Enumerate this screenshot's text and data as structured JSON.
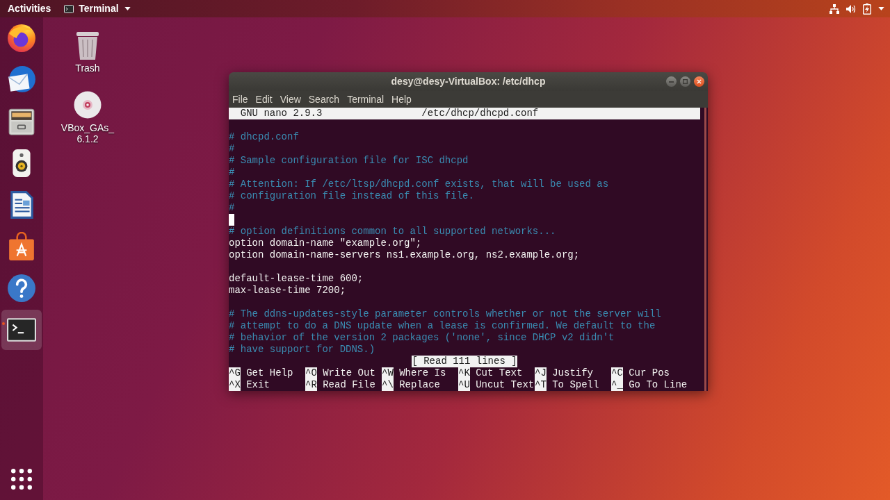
{
  "top_bar": {
    "activities": "Activities",
    "app_menu": "Terminal"
  },
  "dock": {
    "items": [
      {
        "kind": "browser",
        "focused": false,
        "running": false
      },
      {
        "kind": "mail",
        "focused": false,
        "running": false
      },
      {
        "kind": "files",
        "focused": false,
        "running": false
      },
      {
        "kind": "music",
        "focused": false,
        "running": false
      },
      {
        "kind": "writer",
        "focused": false,
        "running": false
      },
      {
        "kind": "software",
        "focused": false,
        "running": false
      },
      {
        "kind": "help",
        "focused": false,
        "running": false
      },
      {
        "kind": "terminal",
        "focused": true,
        "running": true
      }
    ]
  },
  "desktop_icons": [
    {
      "kind": "trash",
      "label_lines": [
        "Trash"
      ]
    },
    {
      "kind": "disc",
      "label_lines": [
        "VBox_GAs_",
        "6.1.2"
      ]
    }
  ],
  "window": {
    "title": "desy@desy-VirtualBox: /etc/dhcp",
    "menu": [
      "File",
      "Edit",
      "View",
      "Search",
      "Terminal",
      "Help"
    ],
    "nano": {
      "version": "GNU nano 2.9.3",
      "file": "/etc/dhcp/dhcpd.conf",
      "lines": [
        {
          "kind": "comment",
          "text": "# dhcpd.conf"
        },
        {
          "kind": "comment",
          "text": "#"
        },
        {
          "kind": "comment",
          "text": "# Sample configuration file for ISC dhcpd"
        },
        {
          "kind": "comment",
          "text": "#"
        },
        {
          "kind": "comment",
          "text": "# Attention: If /etc/ltsp/dhcpd.conf exists, that will be used as"
        },
        {
          "kind": "comment",
          "text": "# configuration file instead of this file."
        },
        {
          "kind": "comment",
          "text": "#"
        },
        {
          "kind": "cursor"
        },
        {
          "kind": "comment",
          "text": "# option definitions common to all supported networks..."
        },
        {
          "kind": "code",
          "text": "option domain-name \"example.org\";"
        },
        {
          "kind": "code",
          "text": "option domain-name-servers ns1.example.org, ns2.example.org;"
        },
        {
          "kind": "blank"
        },
        {
          "kind": "code",
          "text": "default-lease-time 600;"
        },
        {
          "kind": "code",
          "text": "max-lease-time 7200;"
        },
        {
          "kind": "blank"
        },
        {
          "kind": "comment",
          "text": "# The ddns-updates-style parameter controls whether or not the server will"
        },
        {
          "kind": "comment",
          "text": "# attempt to do a DNS update when a lease is confirmed. We default to the"
        },
        {
          "kind": "comment",
          "text": "# behavior of the version 2 packages ('none', since DHCP v2 didn't"
        },
        {
          "kind": "comment",
          "text": "# have support for DDNS.)"
        }
      ],
      "status": "[ Read 111 lines ]",
      "shortcuts": [
        {
          "key": "^G",
          "label": "Get Help"
        },
        {
          "key": "^O",
          "label": "Write Out"
        },
        {
          "key": "^W",
          "label": "Where Is"
        },
        {
          "key": "^K",
          "label": "Cut Text"
        },
        {
          "key": "^J",
          "label": "Justify"
        },
        {
          "key": "^C",
          "label": "Cur Pos"
        },
        {
          "key": "^X",
          "label": "Exit"
        },
        {
          "key": "^R",
          "label": "Read File"
        },
        {
          "key": "^\\",
          "label": "Replace"
        },
        {
          "key": "^U",
          "label": "Uncut Text"
        },
        {
          "key": "^T",
          "label": "To Spell"
        },
        {
          "key": "^_",
          "label": "Go To Line"
        }
      ]
    }
  }
}
